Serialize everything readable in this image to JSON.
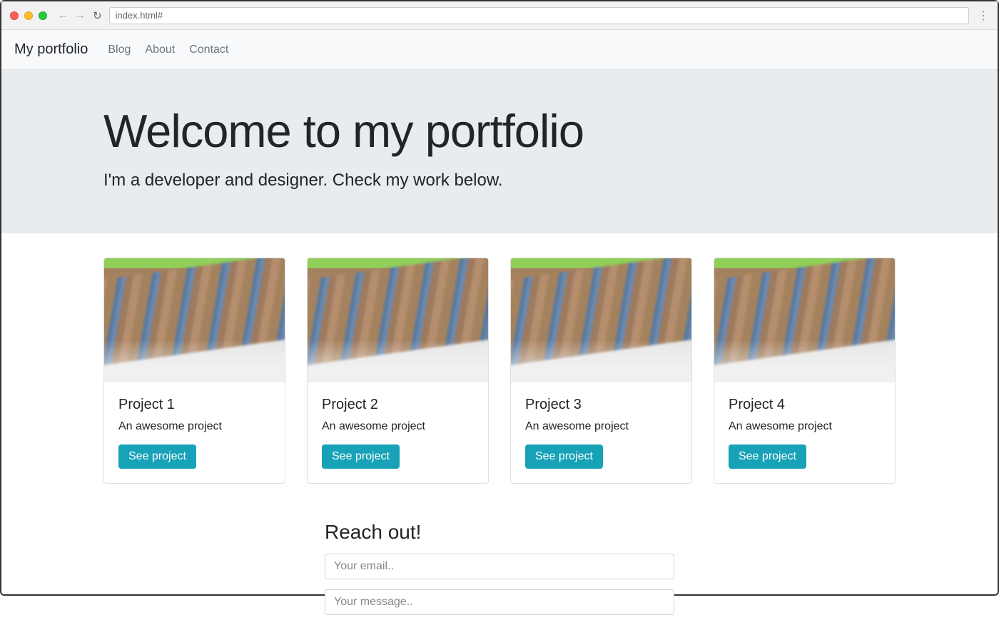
{
  "browser": {
    "url": "index.html#"
  },
  "navbar": {
    "brand": "My portfolio",
    "links": [
      {
        "label": "Blog"
      },
      {
        "label": "About"
      },
      {
        "label": "Contact"
      }
    ]
  },
  "hero": {
    "title": "Welcome to my portfolio",
    "subtitle": "I'm a developer and designer. Check my work below."
  },
  "projects": [
    {
      "title": "Project 1",
      "description": "An awesome project",
      "button": "See project"
    },
    {
      "title": "Project 2",
      "description": "An awesome project",
      "button": "See project"
    },
    {
      "title": "Project 3",
      "description": "An awesome project",
      "button": "See project"
    },
    {
      "title": "Project 4",
      "description": "An awesome project",
      "button": "See project"
    }
  ],
  "contact": {
    "heading": "Reach out!",
    "email_placeholder": "Your email..",
    "message_placeholder": "Your message.."
  },
  "colors": {
    "info": "#17a2b8",
    "navbar_bg": "#f8f9fa",
    "hero_bg": "#e9ecef"
  }
}
